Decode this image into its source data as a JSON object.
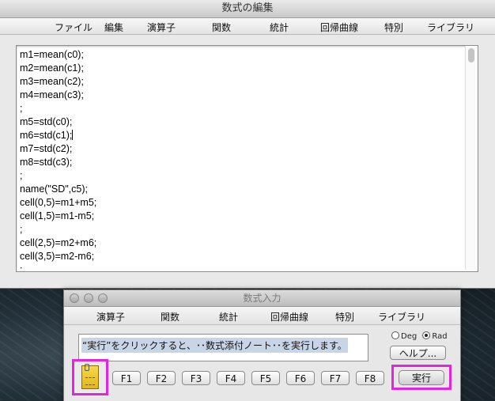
{
  "editor": {
    "title": "数式の編集",
    "menu": [
      "ファイル",
      "編集",
      "演算子",
      "関数",
      "統計",
      "回帰曲線",
      "特別",
      "ライブラリ"
    ],
    "lines": [
      "m1=mean(c0);",
      "m2=mean(c1);",
      "m3=mean(c2);",
      "m4=mean(c3);",
      ";",
      "m5=std(c0);",
      "m6=std(c1);",
      "m7=std(c2);",
      "m8=std(c3);",
      ";",
      "name(\"SD\",c5);",
      "cell(0,5)=m1+m5;",
      "cell(1,5)=m1-m5;",
      ";",
      "cell(2,5)=m2+m6;",
      "cell(3,5)=m2-m6;",
      ";"
    ]
  },
  "palette": {
    "title": "数式入力",
    "menu": [
      "演算子",
      "関数",
      "統計",
      "回帰曲線",
      "特別",
      "ライブラリ"
    ],
    "formula_text": "“実行”をクリックすると、･･数式添付ノート･･を実行します。",
    "deg_label": "Deg",
    "rad_label": "Rad",
    "angle_mode": "Rad",
    "help_label": "ヘルプ...",
    "function_keys": [
      "F1",
      "F2",
      "F3",
      "F4",
      "F5",
      "F6",
      "F7",
      "F8"
    ],
    "run_label": "実行",
    "icons": {
      "note": "note-attachment-icon"
    }
  }
}
